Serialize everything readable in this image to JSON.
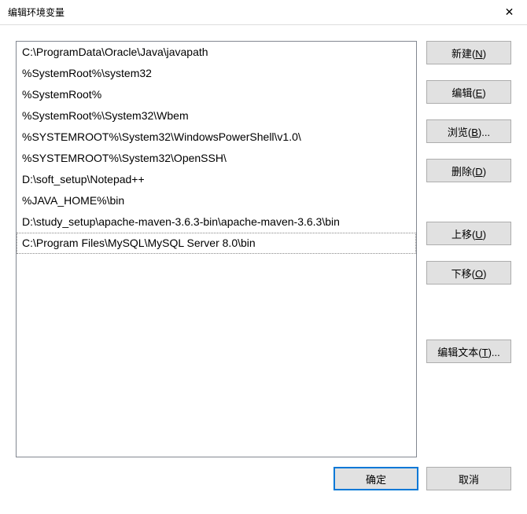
{
  "window": {
    "title": "编辑环境变量"
  },
  "list": {
    "items": [
      "C:\\ProgramData\\Oracle\\Java\\javapath",
      "%SystemRoot%\\system32",
      "%SystemRoot%",
      "%SystemRoot%\\System32\\Wbem",
      "%SYSTEMROOT%\\System32\\WindowsPowerShell\\v1.0\\",
      "%SYSTEMROOT%\\System32\\OpenSSH\\",
      "D:\\soft_setup\\Notepad++",
      "%JAVA_HOME%\\bin",
      "D:\\study_setup\\apache-maven-3.6.3-bin\\apache-maven-3.6.3\\bin",
      "C:\\Program Files\\MySQL\\MySQL Server 8.0\\bin"
    ],
    "selected_index": 9
  },
  "buttons": {
    "new": {
      "text": "新建(",
      "key": "N",
      "suffix": ")"
    },
    "edit": {
      "text": "编辑(",
      "key": "E",
      "suffix": ")"
    },
    "browse": {
      "text": "浏览(",
      "key": "B",
      "suffix": ")..."
    },
    "delete": {
      "text": "删除(",
      "key": "D",
      "suffix": ")"
    },
    "moveup": {
      "text": "上移(",
      "key": "U",
      "suffix": ")"
    },
    "movedown": {
      "text": "下移(",
      "key": "O",
      "suffix": ")"
    },
    "edittext": {
      "text": "编辑文本(",
      "key": "T",
      "suffix": ")..."
    }
  },
  "footer": {
    "ok": "确定",
    "cancel": "取消"
  }
}
